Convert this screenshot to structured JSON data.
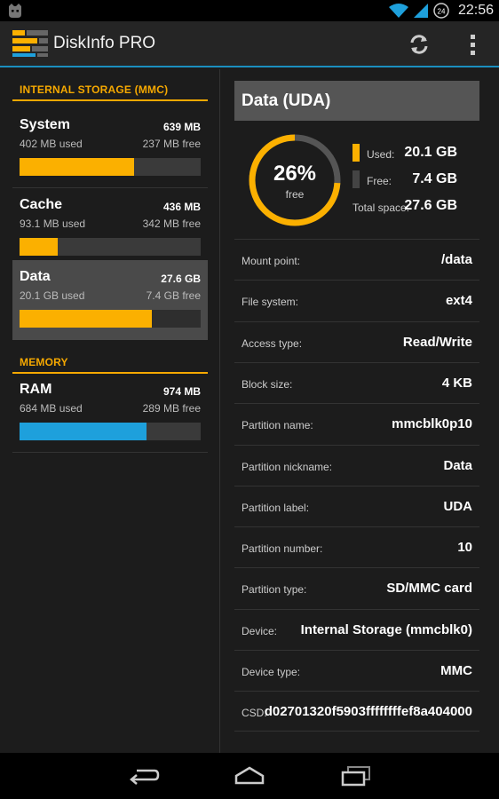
{
  "status_bar": {
    "time": "22:56",
    "icons": [
      "cyanogen-icon",
      "wifi-icon",
      "signal-icon",
      "battery-icon"
    ],
    "battery_level": "24"
  },
  "app": {
    "title": "DiskInfo PRO",
    "accent": "#1b8fbf"
  },
  "left_panel": {
    "sections": [
      {
        "header": "INTERNAL STORAGE (MMC)"
      },
      {
        "header": "MEMORY"
      }
    ],
    "items": [
      {
        "name": "System",
        "total": "639 MB",
        "used": "402 MB used",
        "free": "237 MB free",
        "fraction": 0.63,
        "color": "#fbb000"
      },
      {
        "name": "Cache",
        "total": "436 MB",
        "used": "93.1 MB used",
        "free": "342 MB free",
        "fraction": 0.21,
        "color": "#fbb000"
      },
      {
        "name": "Data",
        "total": "27.6 GB",
        "used": "20.1 GB used",
        "free": "7.4 GB free",
        "fraction": 0.73,
        "color": "#fbb000",
        "selected": true
      },
      {
        "name": "RAM",
        "total": "974 MB",
        "used": "684 MB used",
        "free": "289 MB free",
        "fraction": 0.7,
        "color": "#1ea0dc"
      }
    ]
  },
  "detail": {
    "title": "Data (UDA)",
    "percent_free": "26%",
    "free_label": "free",
    "free_fraction": 0.26,
    "used_color": "#fbb000",
    "free_color": "#555555",
    "legend": {
      "used_label": "Used:",
      "used_value": "20.1 GB",
      "free_label": "Free:",
      "free_value": "7.4 GB",
      "total_label": "Total space:",
      "total_value": "27.6 GB"
    },
    "properties": [
      {
        "key": "Mount point:",
        "value": "/data"
      },
      {
        "key": "File system:",
        "value": "ext4"
      },
      {
        "key": "Access type:",
        "value": "Read/Write"
      },
      {
        "key": "Block size:",
        "value": "4 KB"
      },
      {
        "key": "Partition name:",
        "value": "mmcblk0p10"
      },
      {
        "key": "Partition nickname:",
        "value": "Data"
      },
      {
        "key": "Partition label:",
        "value": "UDA"
      },
      {
        "key": "Partition number:",
        "value": "10"
      },
      {
        "key": "Partition type:",
        "value": "SD/MMC card"
      },
      {
        "key": "Device:",
        "value": "Internal Storage (mmcblk0)"
      },
      {
        "key": "Device type:",
        "value": "MMC"
      },
      {
        "key": "CSD:",
        "value": "d02701320f5903ffffffffef8a404000"
      }
    ]
  },
  "nav_bar": {
    "buttons": [
      "back-icon",
      "home-icon",
      "recents-icon"
    ]
  }
}
